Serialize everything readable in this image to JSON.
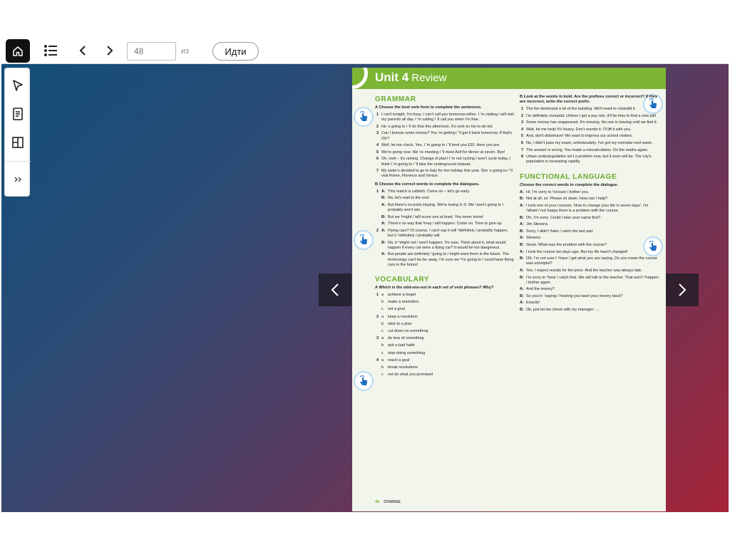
{
  "toolbar": {
    "page_value": "48",
    "of_label": "из",
    "go_label": "Идти"
  },
  "icons": {
    "home": "home-icon",
    "toc": "list-icon",
    "prev": "chevron-left-icon",
    "next": "chevron-right-icon",
    "select": "pointer-icon",
    "notes": "document-icon",
    "layout": "layout-icon",
    "expand": "double-chevron-right-icon",
    "tap": "tap-hand-icon"
  },
  "page": {
    "unit": "Unit 4",
    "unit_sub": "Review",
    "footer_page": "48",
    "footer_label": "CHANGE",
    "grammar": {
      "heading": "GRAMMAR",
      "a_instr": "A  Choose the best verb form to complete the sentences.",
      "a_items": [
        "I can't tonight, I'm busy. I can't call you tomorrow either. I 'm visiting / will visit my parents all day. I 'm calling / 'll call you when I'm free.",
        "He 's going to / 'll do that this afternoon. It's next on his to-do list.",
        "Can I borrow some money? You 're getting / 'll get it back tomorrow, if that's OK?",
        "Well, let me check. Yes, I 'm going to / 'll lend you £20. Here you are.",
        "We're going now. We 're meeting / 'll meet Asif for dinner at seven. Bye!",
        "Oh, look – it's raining. Change of plan! I 'm not cycling / won't cycle today, I think I 'm going to / 'll take the underground instead.",
        "My sister's decided to go to Italy for her holiday this year. She 's going to / 'll visit Rome, Florence and Venice."
      ],
      "b_instr": "B  Choose the correct words to complete the dialogues.",
      "b_dialogs": [
        {
          "num": "1",
          "lines": [
            {
              "s": "A:",
              "t": "This match is rubbish. Come on – let's go early."
            },
            {
              "s": "B:",
              "t": "No, let's wait to the end."
            },
            {
              "s": "A:",
              "t": "But there's no point staying. We're losing 5–0. We ¹aren't going to / probably won't win."
            },
            {
              "s": "B:",
              "t": "But we ²might / will score one at least. You never know!"
            },
            {
              "s": "A:",
              "t": "There's no way that ³may / will happen. Come on. Time to give up."
            }
          ]
        },
        {
          "num": "2",
          "lines": [
            {
              "s": "A:",
              "t": "Flying cars? Of course, I can't say it will ⁴definitely / probably happen, but it ⁵definitely / probably will."
            },
            {
              "s": "B:",
              "t": "No, it ⁶might not / won't happen. I'm sure. Think about it, what would happen if every car were a flying car? It would be too dangerous."
            },
            {
              "s": "A:",
              "t": "But people are definitely ⁷going to / might want them in the future. The technology can't be far away. I'm sure we ⁸'re going to / could have flying cars in the future!"
            }
          ]
        }
      ]
    },
    "vocabulary": {
      "heading": "VOCABULARY",
      "a_instr": "A  Which is the odd-one-out in each set of verb phrases? Why?",
      "sets": [
        {
          "num": "1",
          "opts": [
            {
              "l": "a",
              "t": "achieve a target"
            },
            {
              "l": "b",
              "t": "make a resolution"
            },
            {
              "l": "c",
              "t": "set a goal"
            }
          ]
        },
        {
          "num": "2",
          "opts": [
            {
              "l": "a",
              "t": "keep a resolution"
            },
            {
              "l": "b",
              "t": "stick to a plan"
            },
            {
              "l": "c",
              "t": "cut down on something"
            }
          ]
        },
        {
          "num": "3",
          "opts": [
            {
              "l": "a",
              "t": "do less of something"
            },
            {
              "l": "b",
              "t": "quit a bad habit"
            },
            {
              "l": "c",
              "t": "stop doing something"
            }
          ]
        },
        {
          "num": "4",
          "opts": [
            {
              "l": "a",
              "t": "reach a goal"
            },
            {
              "l": "b",
              "t": "break resolutions"
            },
            {
              "l": "c",
              "t": "not do what you promised"
            }
          ]
        }
      ],
      "b_instr": "B  Look at the words in bold. Are the prefixes correct or incorrect? If they are incorrect, write the correct prefix.",
      "b_items": [
        "The fire destroyed a lot of the building. We'll need to misbuild it.",
        "I'm definitely overpaid. Unless I get a pay rise, it'll be time to find a new job!",
        "Some money has reappeared. It's missing. No one is leaving until we find it.",
        "Wait, let me help! It's heavy. Don't overdo it. I'll lift it with you.",
        "And, don't disbehave! We want to impress our school visitors.",
        "No, I didn't pass my exam, unfortunately. I've got my overtake next week.",
        "The answer is wrong. You made a miscalculation. Do the maths again.",
        "Urban underpopulation isn't a problem now, but it soon will be. The city's population is increasing rapidly."
      ]
    },
    "functional": {
      "heading": "FUNCTIONAL LANGUAGE",
      "instr": "Choose the correct words to complete the dialogue.",
      "lines": [
        {
          "s": "A:",
          "t": "Hi. I'm sorry to ¹excuse / bother you."
        },
        {
          "s": "B:",
          "t": "Not at all, sir. Please sit down. How can I help?"
        },
        {
          "s": "A:",
          "t": "I took one of your courses, 'How to change your life in seven days'. I'm ²afraid / not happy there is a problem with the course."
        },
        {
          "s": "B:",
          "t": "Oh, I'm sorry. Could I take your name first?"
        },
        {
          "s": "A:",
          "t": "Jim Stevens."
        },
        {
          "s": "B:",
          "t": "Sorry, I didn't ³take / catch the last part."
        },
        {
          "s": "A:",
          "t": "Stevens."
        },
        {
          "s": "B:",
          "t": "Great. What was the problem with the course?"
        },
        {
          "s": "A:",
          "t": "I took the course ten days ago. But my life hasn't changed!"
        },
        {
          "s": "B:",
          "t": "OK, I'm not sure I ⁴have / get what you are saying. Do you mean the course was unhelpful?"
        },
        {
          "s": "A:",
          "t": "Yes. I expect results for the price. And the teacher was always late."
        },
        {
          "s": "B:",
          "t": "I'm sorry to ⁵hear / catch that. We will talk to the teacher. That won't ⁶happen / bother again."
        },
        {
          "s": "A:",
          "t": "And the money?"
        },
        {
          "s": "B:",
          "t": "So you're ⁷saying / hearing you want your money back?"
        },
        {
          "s": "A:",
          "t": "Exactly!"
        },
        {
          "s": "B:",
          "t": "Ok, just let me check with my manager ...."
        }
      ]
    }
  }
}
